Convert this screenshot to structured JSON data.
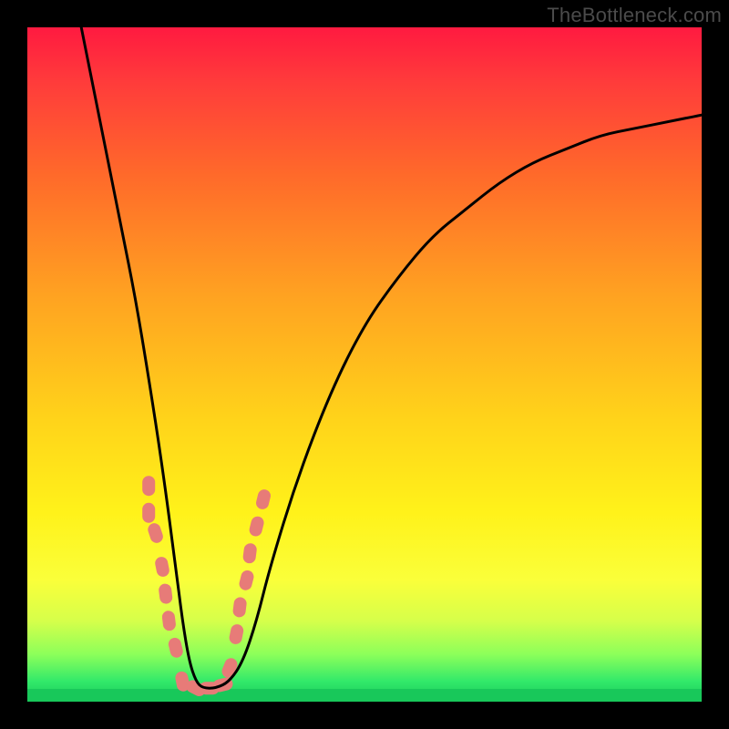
{
  "watermark": "TheBottleneck.com",
  "colors": {
    "gradient_top": "#ff1a40",
    "gradient_mid": "#ffd31a",
    "gradient_bottom": "#18c85a",
    "curve": "#000000",
    "marker": "#e77b78",
    "frame": "#000000"
  },
  "chart_data": {
    "type": "line",
    "title": "",
    "xlabel": "",
    "ylabel": "",
    "xlim": [
      0,
      100
    ],
    "ylim": [
      0,
      100
    ],
    "note": "Axes are unlabeled. x is horizontal position (0 left, 100 right), y is vertical (0 bottom, 100 top). Values estimated from pixel position.",
    "series": [
      {
        "name": "bottleneck-curve",
        "x": [
          8,
          10,
          12,
          14,
          16,
          18,
          20,
          22,
          23,
          24,
          25,
          26,
          28,
          30,
          32,
          34,
          36,
          40,
          45,
          50,
          55,
          60,
          65,
          70,
          75,
          80,
          85,
          90,
          95,
          100
        ],
        "y": [
          100,
          90,
          80,
          70,
          60,
          48,
          35,
          20,
          12,
          6,
          3,
          2,
          2,
          3,
          6,
          12,
          20,
          33,
          46,
          56,
          63,
          69,
          73,
          77,
          80,
          82,
          84,
          85,
          86,
          87
        ]
      }
    ],
    "markers": {
      "name": "highlighted-points",
      "note": "Pink rounded markers clustered near the curve minimum and lower arms.",
      "points": [
        {
          "x": 18,
          "y": 32
        },
        {
          "x": 18,
          "y": 28
        },
        {
          "x": 19,
          "y": 25
        },
        {
          "x": 20,
          "y": 20
        },
        {
          "x": 20.5,
          "y": 16
        },
        {
          "x": 21,
          "y": 12
        },
        {
          "x": 22,
          "y": 8
        },
        {
          "x": 23,
          "y": 3
        },
        {
          "x": 25,
          "y": 2
        },
        {
          "x": 27,
          "y": 2
        },
        {
          "x": 29,
          "y": 2.5
        },
        {
          "x": 30,
          "y": 5
        },
        {
          "x": 31,
          "y": 10
        },
        {
          "x": 31.5,
          "y": 14
        },
        {
          "x": 32.5,
          "y": 18
        },
        {
          "x": 33,
          "y": 22
        },
        {
          "x": 34,
          "y": 26
        },
        {
          "x": 35,
          "y": 30
        }
      ]
    }
  }
}
